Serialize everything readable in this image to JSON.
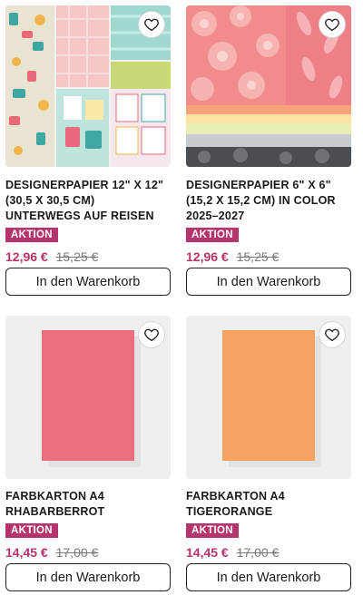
{
  "products": [
    {
      "title": "Designerpapier 12\" x 12\" (30,5 x 30,5 cm) Unterwegs auf Reisen",
      "badge": "AKTION",
      "price": "12,96 €",
      "old_price": "15,25 €",
      "button": "In den Warenkorb"
    },
    {
      "title": "Designerpapier 6\" x 6\" (15,2 x 15,2 cm) In Color 2025–2027",
      "badge": "AKTION",
      "price": "12,96 €",
      "old_price": "15,25 €",
      "button": "In den Warenkorb"
    },
    {
      "title": "Farbkarton A4 Rhabarberrot",
      "badge": "AKTION",
      "price": "14,45 €",
      "old_price": "17,00 €",
      "button": "In den Warenkorb",
      "swatch": "#ec6f7e"
    },
    {
      "title": "Farbkarton A4 Tigerorange",
      "badge": "AKTION",
      "price": "14,45 €",
      "old_price": "17,00 €",
      "button": "In den Warenkorb",
      "swatch": "#f5a262"
    }
  ],
  "icons": {
    "favorite": "heart-outline-icon"
  },
  "colors": {
    "accent": "#b5346c",
    "text": "#1a1a1a"
  }
}
